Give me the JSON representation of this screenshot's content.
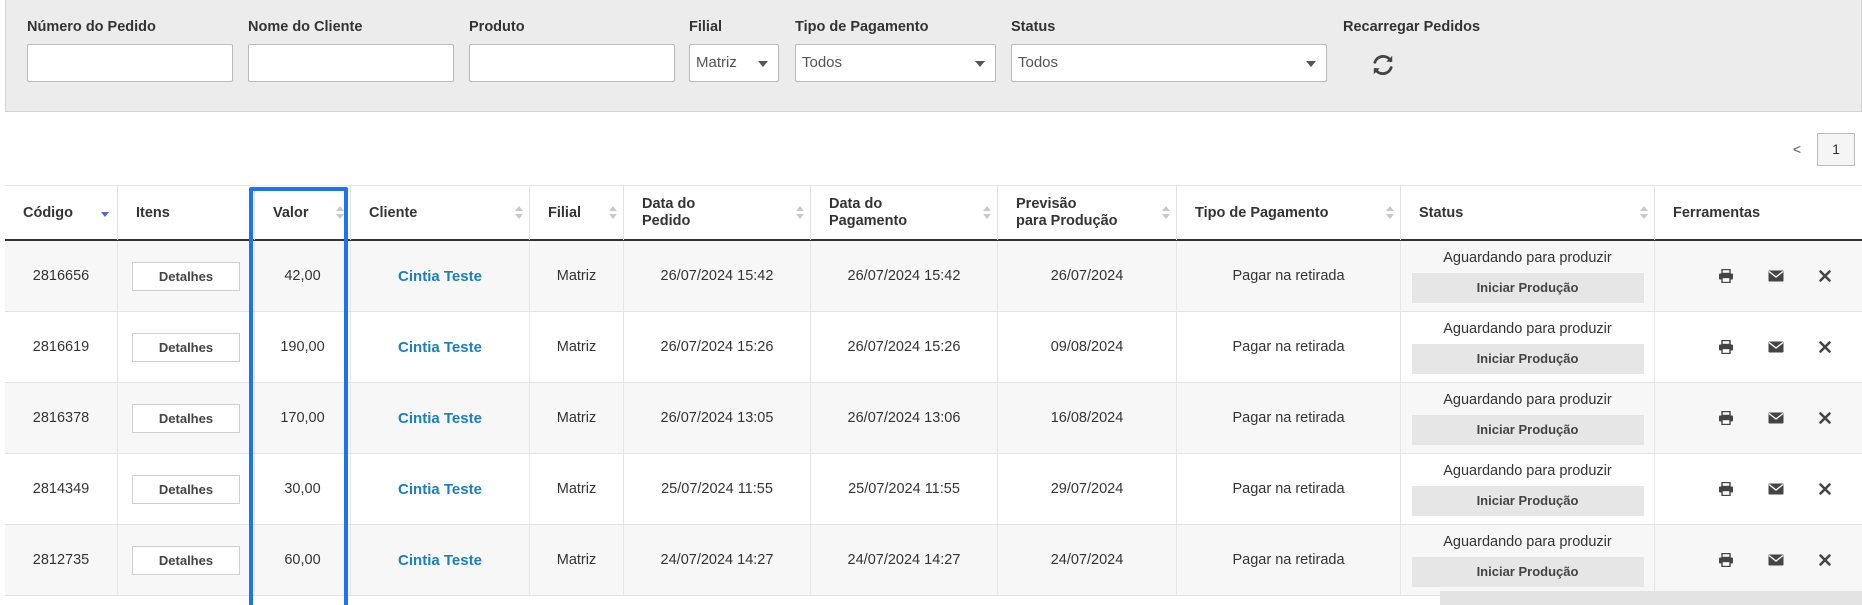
{
  "filters": {
    "order_number": {
      "label": "Número do Pedido",
      "value": ""
    },
    "client_name": {
      "label": "Nome do Cliente",
      "value": ""
    },
    "product": {
      "label": "Produto",
      "value": ""
    },
    "branch": {
      "label": "Filial",
      "selected": "Matriz"
    },
    "payment_type": {
      "label": "Tipo de Pagamento",
      "selected": "Todos"
    },
    "status": {
      "label": "Status",
      "selected": "Todos"
    },
    "reload": {
      "label": "Recarregar Pedidos",
      "icon": "refresh-icon"
    }
  },
  "pagination": {
    "prev": "<",
    "current": "1"
  },
  "table": {
    "columns": [
      {
        "label": "Código",
        "sort": "desc"
      },
      {
        "label": "Itens",
        "sort": "none"
      },
      {
        "label": "Valor",
        "sort": "both"
      },
      {
        "label": "Cliente",
        "sort": "both"
      },
      {
        "label": "Filial",
        "sort": "both"
      },
      {
        "label": "Data do\nPedido",
        "sort": "both"
      },
      {
        "label": "Data do\nPagamento",
        "sort": "both"
      },
      {
        "label": "Previsão\npara Produção",
        "sort": "both"
      },
      {
        "label": "Tipo de Pagamento",
        "sort": "both"
      },
      {
        "label": "Status",
        "sort": "both"
      },
      {
        "label": "Ferramentas",
        "sort": "none"
      }
    ],
    "details_label": "Detalhes",
    "start_label": "Iniciar Produção",
    "tool_icons": [
      "print-icon",
      "envelope-icon",
      "close-icon"
    ],
    "rows": [
      {
        "code": "2816656",
        "value": "42,00",
        "client": "Cintia Teste",
        "branch": "Matriz",
        "order_date": "26/07/2024 15:42",
        "payment_date": "26/07/2024 15:42",
        "forecast": "26/07/2024",
        "payment_type": "Pagar na retirada",
        "status": "Aguardando para produzir"
      },
      {
        "code": "2816619",
        "value": "190,00",
        "client": "Cintia Teste",
        "branch": "Matriz",
        "order_date": "26/07/2024 15:26",
        "payment_date": "26/07/2024 15:26",
        "forecast": "09/08/2024",
        "payment_type": "Pagar na retirada",
        "status": "Aguardando para produzir"
      },
      {
        "code": "2816378",
        "value": "170,00",
        "client": "Cintia Teste",
        "branch": "Matriz",
        "order_date": "26/07/2024 13:05",
        "payment_date": "26/07/2024 13:06",
        "forecast": "16/08/2024",
        "payment_type": "Pagar na retirada",
        "status": "Aguardando para produzir"
      },
      {
        "code": "2814349",
        "value": "30,00",
        "client": "Cintia Teste",
        "branch": "Matriz",
        "order_date": "25/07/2024 11:55",
        "payment_date": "25/07/2024 11:55",
        "forecast": "29/07/2024",
        "payment_type": "Pagar na retirada",
        "status": "Aguardando para produzir"
      },
      {
        "code": "2812735",
        "value": "60,00",
        "client": "Cintia Teste",
        "branch": "Matriz",
        "order_date": "24/07/2024 14:27",
        "payment_date": "24/07/2024 14:27",
        "forecast": "24/07/2024",
        "payment_type": "Pagar na retirada",
        "status": "Aguardando para produzir"
      }
    ]
  },
  "colors": {
    "accent_link": "#1b7fb9",
    "highlight": "#1e74f0",
    "sort_active": "#5468c7"
  }
}
